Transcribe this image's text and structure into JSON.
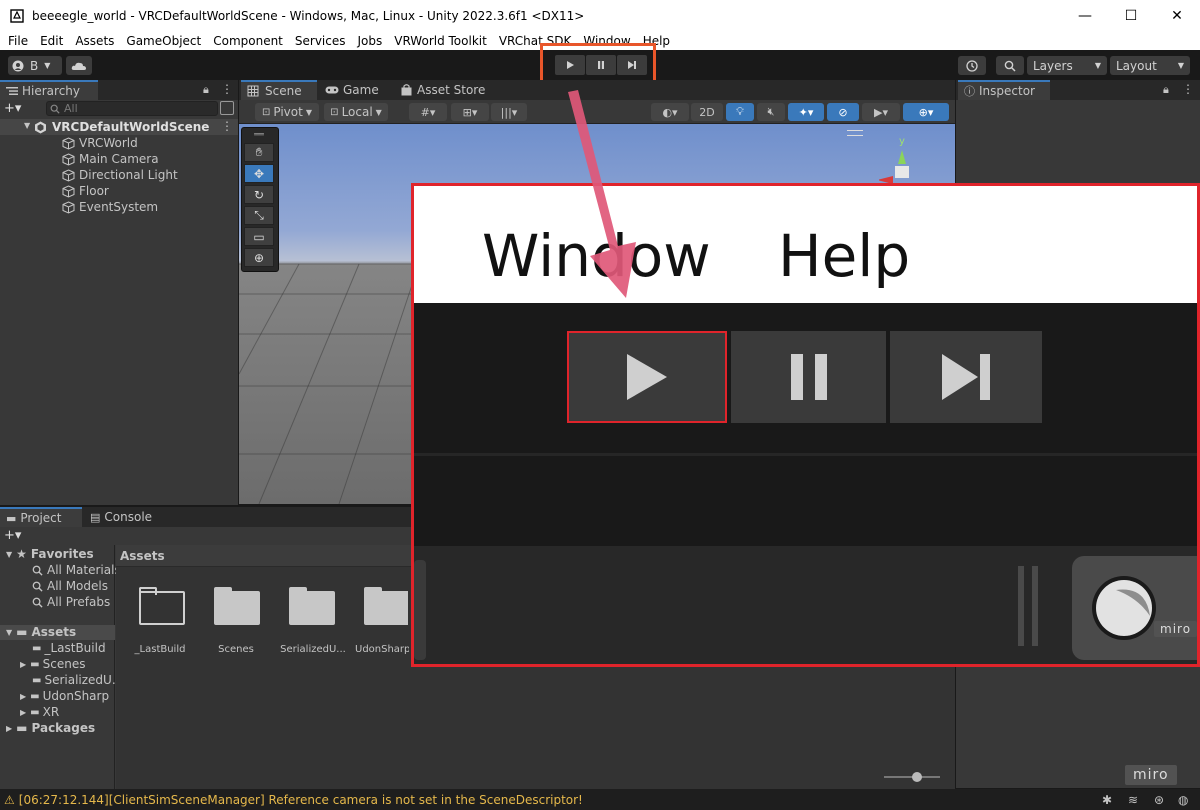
{
  "window": {
    "title": "beeeegle_world - VRCDefaultWorldScene - Windows, Mac, Linux - Unity 2022.3.6f1 <DX11>",
    "minimize": "—",
    "maximize": "☐",
    "close": "✕"
  },
  "menu": [
    "File",
    "Edit",
    "Assets",
    "GameObject",
    "Component",
    "Services",
    "Jobs",
    "VRWorld Toolkit",
    "VRChat SDK",
    "Window",
    "Help"
  ],
  "toolbar": {
    "account_label": "B",
    "layers_label": "Layers",
    "layout_label": "Layout"
  },
  "hierarchy": {
    "tab": "Hierarchy",
    "search_placeholder": "All",
    "scene_name": "VRCDefaultWorldScene",
    "items": [
      "VRCWorld",
      "Main Camera",
      "Directional Light",
      "Floor",
      "EventSystem"
    ]
  },
  "scene_tabs": {
    "scene": "Scene",
    "game": "Game",
    "asset_store": "Asset Store"
  },
  "scene_toolbar": {
    "pivot": "Pivot",
    "local": "Local",
    "mode_2d": "2D",
    "gizmo_axis": "y"
  },
  "inspector": {
    "tab": "Inspector"
  },
  "project": {
    "tab_project": "Project",
    "tab_console": "Console",
    "favorites_label": "Favorites",
    "favorites": [
      "All Materials",
      "All Models",
      "All Prefabs"
    ],
    "assets_label": "Assets",
    "asset_folders": [
      "_LastBuild",
      "Scenes",
      "SerializedU...",
      "UdonSharp",
      "XR"
    ],
    "packages_label": "Packages",
    "breadcrumb": "Assets",
    "grid_items": [
      "_LastBuild",
      "Scenes",
      "SerializedU...",
      "UdonSharp"
    ]
  },
  "status": {
    "message": "[06:27:12.144][ClientSimSceneManager] Reference camera is not set in the SceneDescriptor!"
  },
  "zoom_overlay": {
    "menu_window": "Window",
    "menu_help": "Help",
    "watermark": "miro"
  },
  "watermark": "miro",
  "colors": {
    "highlight_orange": "#e8562a",
    "highlight_red": "#e0242b",
    "arrow_pink": "#e05878",
    "warning_yellow": "#e5b84b",
    "selection_blue": "#3a79bb"
  }
}
